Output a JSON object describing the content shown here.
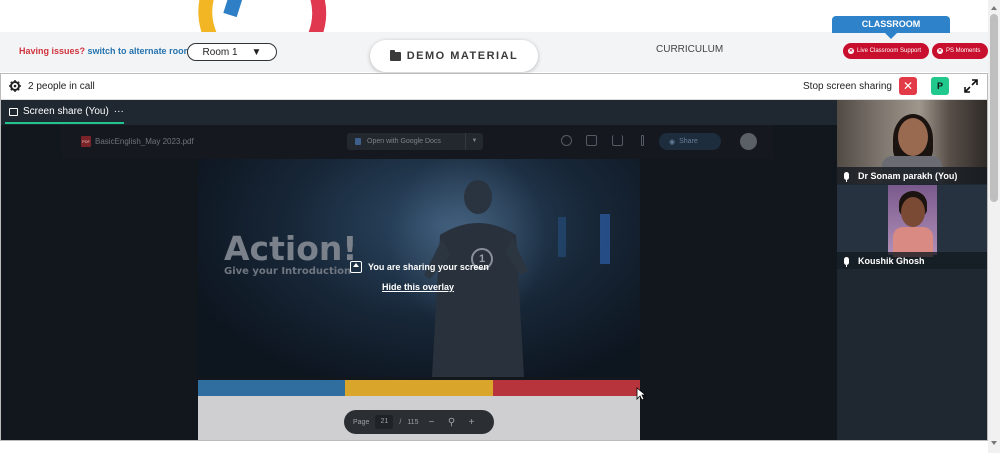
{
  "header": {
    "issues_text": "Having issues?",
    "alternate_room_link": "switch to alternate room",
    "room_select_value": "Room 1",
    "demo_material_label": "DEMO MATERIAL",
    "curriculum_label": "CURRICULUM",
    "classroom_tab_label": "CLASSROOM",
    "live_support_label": "Live Classroom Support",
    "ps_moments_label": "PS Moments"
  },
  "call": {
    "people_count_text": "2 people in call",
    "stop_sharing_label": "Stop screen sharing",
    "close_glyph": "✕",
    "user_initial": "P",
    "share_tab_label": "Screen share (You)",
    "share_tab_more": "···"
  },
  "shared_screen": {
    "pdf_filename": "BasicEnglish_May 2023.pdf",
    "open_with_label": "Open with Google Docs",
    "share_label": "Share",
    "slide_title": "Action!",
    "slide_subtitle": "Give your Introduction",
    "slide_number": "1",
    "sharing_message": "You are sharing your screen",
    "hide_overlay_link": "Hide this overlay",
    "page_label": "Page",
    "current_page": "21",
    "page_separator": "/",
    "total_pages": "115",
    "zoom_out_glyph": "−",
    "zoom_in_glyph": "+",
    "strip_colors": [
      "#2f6e9e",
      "#d9a52a",
      "#b8343c"
    ]
  },
  "participants": [
    {
      "name": "Dr Sonam parakh (You)"
    },
    {
      "name": "Koushik Ghosh"
    }
  ],
  "icons": {
    "pdf_badge": "PDF",
    "gdocs_caret": "▼",
    "room_caret": "▼"
  }
}
